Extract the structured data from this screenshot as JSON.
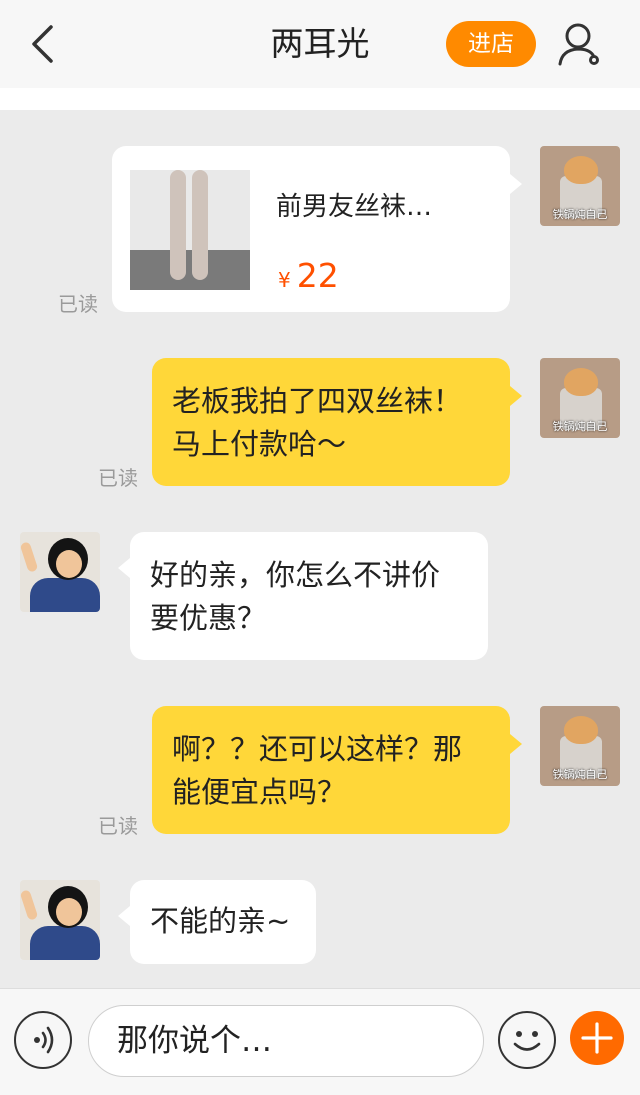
{
  "header": {
    "title": "两耳光",
    "shop_button": "进店"
  },
  "messages": [
    {
      "type": "product",
      "title": "前男友丝袜…",
      "price_symbol": "¥",
      "price": "22",
      "status": "已读",
      "avatar_caption": "铁锅炖自己"
    },
    {
      "type": "sent",
      "lines": [
        "老板我拍了四双丝袜！",
        "马上付款哈～"
      ],
      "status": "已读",
      "avatar_caption": "铁锅炖自己"
    },
    {
      "type": "received",
      "lines": [
        "好的亲，你怎么不讲价",
        "要优惠？"
      ]
    },
    {
      "type": "sent",
      "lines": [
        "啊？？还可以这样？那",
        "能便宜点吗？"
      ],
      "status": "已读",
      "avatar_caption": "铁锅炖自己"
    },
    {
      "type": "received",
      "lines": [
        "不能的亲~"
      ]
    }
  ],
  "input": {
    "value": "那你说个…"
  },
  "colors": {
    "accent": "#ff8a00",
    "bubble_sent": "#ffd739",
    "bubble_received": "#ffffff",
    "price": "#ff5000"
  }
}
